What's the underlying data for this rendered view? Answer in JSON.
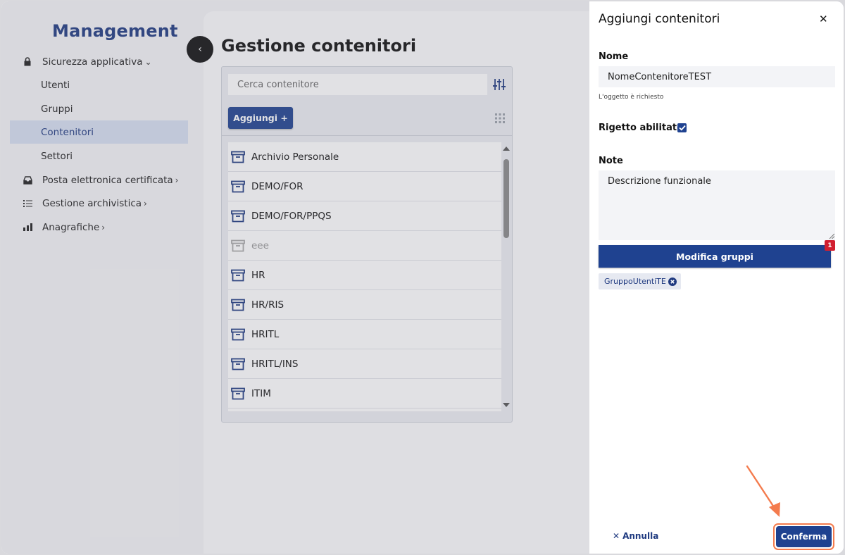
{
  "sidebar": {
    "brand": "Management",
    "items": [
      {
        "label": "Sicurezza applicativa",
        "icon": "lock-icon"
      },
      {
        "label": "Utenti"
      },
      {
        "label": "Gruppi"
      },
      {
        "label": "Contenitori"
      },
      {
        "label": "Settori"
      },
      {
        "label": "Posta elettronica certificata",
        "icon": "inbox-icon"
      },
      {
        "label": "Gestione archivistica",
        "icon": "list-icon"
      },
      {
        "label": "Anagrafiche",
        "icon": "chart-icon"
      }
    ]
  },
  "main": {
    "title": "Gestione contenitori",
    "search_placeholder": "Cerca contenitore",
    "add_label": "Aggiungi +",
    "list": [
      {
        "label": "Archivio Personale"
      },
      {
        "label": "DEMO/FOR"
      },
      {
        "label": "DEMO/FOR/PPQS"
      },
      {
        "label": "eee"
      },
      {
        "label": "HR"
      },
      {
        "label": "HR/RIS"
      },
      {
        "label": "HRITL"
      },
      {
        "label": "HRITL/INS"
      },
      {
        "label": "ITIM"
      }
    ]
  },
  "drawer": {
    "title": "Aggiungi contenitori",
    "name_label": "Nome",
    "name_value": "NomeContenitoreTEST",
    "name_hint": "L'oggetto è richiesto",
    "reject_label": "Rigetto abilitato",
    "reject_checked": true,
    "note_label": "Note",
    "note_value": "Descrizione funzionale",
    "groups_button": "Modifica gruppi",
    "groups_count": "1",
    "chip": "GruppoUtentiTE",
    "cancel_label": "Annulla",
    "confirm_label": "Conferma"
  },
  "colors": {
    "primary": "#1f4290",
    "brand": "#1f3a80",
    "highlight": "#f47b4d",
    "badge": "#d21f30"
  }
}
